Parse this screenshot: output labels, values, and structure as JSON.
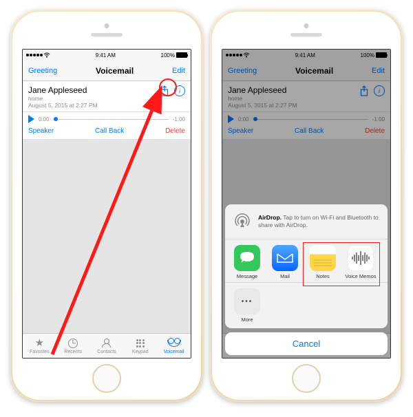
{
  "status": {
    "carrier_dots": 5,
    "wifi": true,
    "time": "9:41 AM",
    "battery_pct": "100%"
  },
  "nav": {
    "left": "Greeting",
    "title": "Voicemail",
    "right": "Edit"
  },
  "voicemail": {
    "name": "Jane Appleseed",
    "source": "home",
    "date": "August 5, 2015 at 2:27 PM",
    "elapsed": "0:00",
    "remaining": "-1:00"
  },
  "actions": {
    "speaker": "Speaker",
    "callback": "Call Back",
    "delete": "Delete"
  },
  "tabs": {
    "favorites": "Favorites",
    "recents": "Recents",
    "contacts": "Contacts",
    "keypad": "Keypad",
    "voicemail": "Voicemail"
  },
  "share": {
    "airdrop_title": "AirDrop.",
    "airdrop_body": "Tap to turn on Wi-Fi and Bluetooth to share with AirDrop.",
    "apps": {
      "message": "Message",
      "mail": "Mail",
      "notes": "Notes",
      "voicememos": "Voice Memos"
    },
    "more": "More",
    "cancel": "Cancel"
  }
}
